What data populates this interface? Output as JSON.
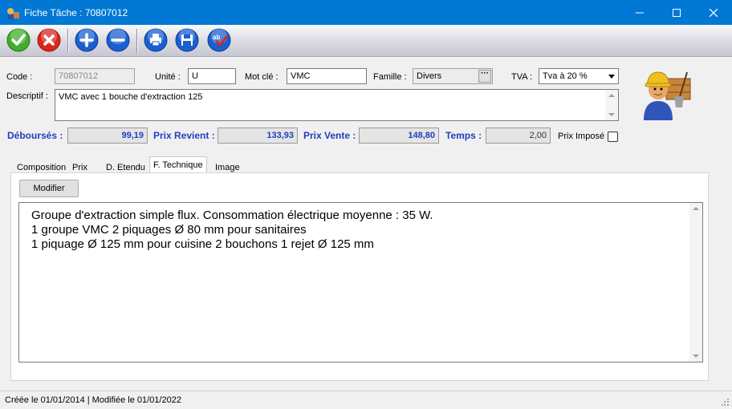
{
  "window": {
    "title": "Fiche Tâche : 70807012"
  },
  "toolbar": {
    "buttons": [
      {
        "name": "validate",
        "icon": "check-icon",
        "color": "#3fae2a"
      },
      {
        "name": "cancel",
        "icon": "x-icon",
        "color": "#d9261c"
      },
      {
        "name": "add",
        "icon": "plus-icon",
        "color": "#1a5fd1"
      },
      {
        "name": "remove",
        "icon": "minus-icon",
        "color": "#1a5fd1"
      },
      {
        "name": "print",
        "icon": "printer-icon",
        "color": "#1a5fd1"
      },
      {
        "name": "save",
        "icon": "floppy-disk-icon",
        "color": "#1a5fd1"
      },
      {
        "name": "spellcheck",
        "icon": "spellcheck-icon",
        "color": "#1a5fd1"
      }
    ]
  },
  "form": {
    "code_label": "Code :",
    "code_value": "70807012",
    "unite_label": "Unité :",
    "unite_value": "U",
    "motcle_label": "Mot clé :",
    "motcle_value": "VMC",
    "famille_label": "Famille :",
    "famille_value": "Divers",
    "tva_label": "TVA :",
    "tva_value": "Tva à 20 %",
    "descriptif_label": "Descriptif :",
    "descriptif_value": "VMC avec 1 bouche d'extraction 125"
  },
  "totals": {
    "debourses_label": "Déboursés :",
    "debourses_value": "99,19",
    "prix_revient_label": "Prix Revient :",
    "prix_revient_value": "133,93",
    "prix_vente_label": "Prix Vente :",
    "prix_vente_value": "148,80",
    "temps_label": "Temps :",
    "temps_value": "2,00",
    "prix_impose_label": "Prix Imposé",
    "prix_impose_checked": false
  },
  "tabs": [
    {
      "label": "Composition",
      "active": false
    },
    {
      "label": "Prix",
      "active": false
    },
    {
      "label": "D. Etendu",
      "active": false
    },
    {
      "label": "F. Technique",
      "active": true
    },
    {
      "label": "Image",
      "active": false
    }
  ],
  "technique": {
    "modifier_label": "Modifier",
    "lines": [
      "Groupe d'extraction simple flux. Consommation électrique moyenne : 35 W.",
      "1 groupe VMC 2 piquages Ø 80 mm pour sanitaires",
      "1 piquage Ø 125 mm pour cuisine 2 bouchons 1 rejet Ø 125 mm"
    ]
  },
  "status": {
    "text": "Créée le 01/01/2014 | Modifiée le 01/01/2022"
  },
  "colors": {
    "titlebar": "#0078d4",
    "label_blue": "#1f3fbf"
  }
}
